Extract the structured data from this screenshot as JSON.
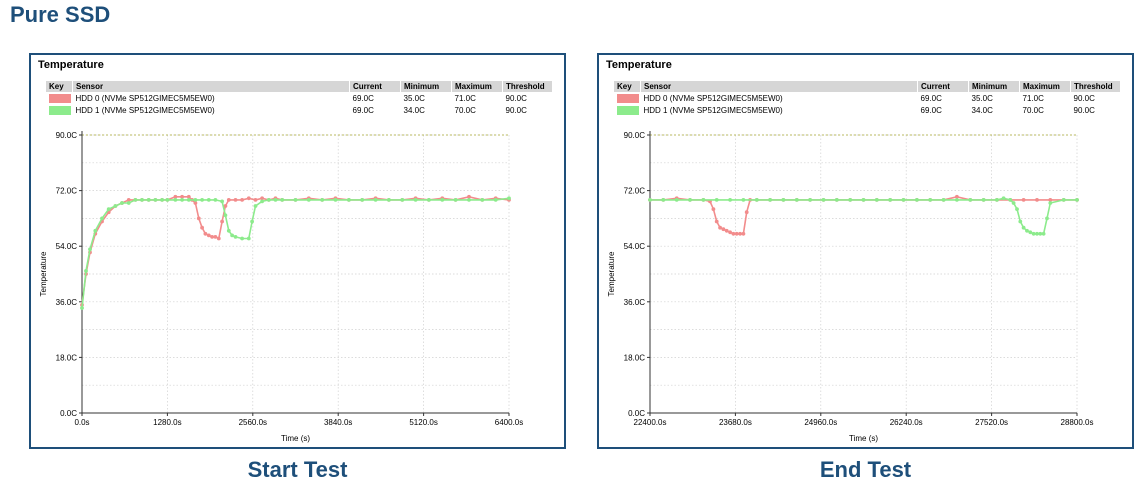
{
  "page_title": "Pure SSD",
  "panels": [
    {
      "title": "Temperature",
      "caption": "Start Test",
      "table": {
        "headers": [
          "Key",
          "Sensor",
          "Current",
          "Minimum",
          "Maximum",
          "Threshold"
        ],
        "rows": [
          {
            "sensor": "HDD 0 (NVMe SP512GIMEC5M5EW0)",
            "current": "69.0C",
            "minimum": "35.0C",
            "maximum": "71.0C",
            "threshold": "90.0C"
          },
          {
            "sensor": "HDD 1 (NVMe SP512GIMEC5M5EW0)",
            "current": "69.0C",
            "minimum": "34.0C",
            "maximum": "70.0C",
            "threshold": "90.0C"
          }
        ]
      }
    },
    {
      "title": "Temperature",
      "caption": "End Test",
      "table": {
        "headers": [
          "Key",
          "Sensor",
          "Current",
          "Minimum",
          "Maximum",
          "Threshold"
        ],
        "rows": [
          {
            "sensor": "HDD 0 (NVMe SP512GIMEC5M5EW0)",
            "current": "69.0C",
            "minimum": "35.0C",
            "maximum": "71.0C",
            "threshold": "90.0C"
          },
          {
            "sensor": "HDD 1 (NVMe SP512GIMEC5M5EW0)",
            "current": "69.0C",
            "minimum": "34.0C",
            "maximum": "70.0C",
            "threshold": "90.0C"
          }
        ]
      }
    }
  ],
  "chart_data": [
    {
      "type": "line",
      "xlabel": "Time (s)",
      "ylabel": "Temperature",
      "xlim": [
        0,
        6400
      ],
      "ylim": [
        0,
        90
      ],
      "x_ticks": [
        0,
        1280,
        2560,
        3840,
        5120,
        6400
      ],
      "x_tick_labels": [
        "0.0s",
        "1280.0s",
        "2560.0s",
        "3840.0s",
        "5120.0s",
        "6400.0s"
      ],
      "y_ticks": [
        0,
        18,
        36,
        54,
        72,
        90
      ],
      "y_tick_labels": [
        "0.0C",
        "18.0C",
        "36.0C",
        "54.0C",
        "72.0C",
        "90.0C"
      ],
      "threshold": 90,
      "threshold_color": "#b8b860",
      "grid": true,
      "series": [
        {
          "name": "HDD 0 (NVMe SP512GIMEC5M5EW0)",
          "color": "#f28c8c",
          "x": [
            0,
            60,
            120,
            200,
            300,
            400,
            500,
            600,
            700,
            800,
            900,
            1000,
            1100,
            1200,
            1280,
            1400,
            1500,
            1600,
            1650,
            1700,
            1750,
            1800,
            1850,
            1900,
            1950,
            2000,
            2050,
            2100,
            2150,
            2200,
            2300,
            2400,
            2500,
            2600,
            2700,
            2800,
            2900,
            3000,
            3200,
            3400,
            3600,
            3800,
            4000,
            4200,
            4400,
            4600,
            4800,
            5000,
            5200,
            5400,
            5600,
            5800,
            6000,
            6200,
            6400
          ],
          "y": [
            35,
            45,
            52,
            58,
            62,
            65,
            67,
            68,
            69,
            69,
            69,
            69,
            69,
            69,
            69,
            70,
            70,
            70,
            69,
            68,
            63,
            60,
            58,
            57.5,
            57,
            57,
            56.5,
            62,
            67,
            69,
            69,
            69,
            69.5,
            69,
            69.5,
            69,
            69.5,
            69,
            69,
            69.5,
            69,
            69.5,
            69,
            69,
            69.5,
            69,
            69,
            69.5,
            69,
            69.5,
            69,
            70,
            69,
            69.5,
            69
          ]
        },
        {
          "name": "HDD 1 (NVMe SP512GIMEC5M5EW0)",
          "color": "#8ceb8c",
          "x": [
            0,
            60,
            120,
            200,
            300,
            400,
            500,
            600,
            700,
            800,
            900,
            1000,
            1100,
            1200,
            1280,
            1400,
            1500,
            1600,
            1700,
            1800,
            1900,
            2000,
            2100,
            2150,
            2200,
            2250,
            2300,
            2400,
            2500,
            2550,
            2600,
            2700,
            2800,
            2900,
            3000,
            3200,
            3400,
            3600,
            3800,
            4000,
            4200,
            4400,
            4600,
            4800,
            5000,
            5200,
            5400,
            5600,
            5800,
            6000,
            6200,
            6400
          ],
          "y": [
            34,
            46,
            53,
            59,
            63,
            66,
            67,
            68,
            68,
            69,
            69,
            69,
            69,
            69,
            69,
            69,
            69,
            69,
            69,
            69,
            69,
            69,
            68.5,
            64,
            59,
            57.5,
            57,
            56.5,
            56.5,
            62,
            67,
            68.5,
            69,
            69,
            69,
            69,
            69,
            69,
            69,
            69,
            69,
            69,
            69,
            69,
            69,
            69,
            69,
            69,
            69,
            69,
            69,
            69.5
          ]
        }
      ]
    },
    {
      "type": "line",
      "xlabel": "Time (s)",
      "ylabel": "Temperature",
      "xlim": [
        22400,
        28800
      ],
      "ylim": [
        0,
        90
      ],
      "x_ticks": [
        22400,
        23680,
        24960,
        26240,
        27520,
        28800
      ],
      "x_tick_labels": [
        "22400.0s",
        "23680.0s",
        "24960.0s",
        "26240.0s",
        "27520.0s",
        "28800.0s"
      ],
      "y_ticks": [
        0,
        18,
        36,
        54,
        72,
        90
      ],
      "y_tick_labels": [
        "0.0C",
        "18.0C",
        "36.0C",
        "54.0C",
        "72.0C",
        "90.0C"
      ],
      "threshold": 90,
      "threshold_color": "#b8b860",
      "grid": true,
      "series": [
        {
          "name": "HDD 0 (NVMe SP512GIMEC5M5EW0)",
          "color": "#f28c8c",
          "x": [
            22400,
            22600,
            22800,
            23000,
            23200,
            23300,
            23350,
            23400,
            23450,
            23500,
            23550,
            23600,
            23650,
            23700,
            23750,
            23800,
            23850,
            23900,
            24000,
            24200,
            24400,
            24600,
            24800,
            25000,
            25200,
            25400,
            25600,
            25800,
            26000,
            26200,
            26400,
            26600,
            26800,
            27000,
            27200,
            27400,
            27600,
            27800,
            28000,
            28200,
            28400,
            28600,
            28800
          ],
          "y": [
            69,
            69,
            69.5,
            69,
            69,
            68.5,
            66,
            62,
            60,
            59.5,
            59,
            58.5,
            58,
            58,
            58,
            58,
            65,
            69,
            69,
            69,
            69,
            69,
            69,
            69,
            69,
            69,
            69,
            69,
            69,
            69,
            69,
            69,
            69,
            70,
            69,
            69,
            69,
            69,
            69,
            69,
            69,
            69,
            69
          ]
        },
        {
          "name": "HDD 1 (NVMe SP512GIMEC5M5EW0)",
          "color": "#8ceb8c",
          "x": [
            22400,
            22600,
            22800,
            23000,
            23200,
            23400,
            23600,
            23800,
            24000,
            24200,
            24400,
            24600,
            24800,
            25000,
            25200,
            25400,
            25600,
            25800,
            26000,
            26200,
            26400,
            26600,
            26800,
            27000,
            27200,
            27400,
            27600,
            27700,
            27800,
            27850,
            27900,
            27950,
            28000,
            28050,
            28100,
            28150,
            28200,
            28250,
            28300,
            28350,
            28400,
            28600,
            28800
          ],
          "y": [
            69,
            69,
            69,
            69,
            69,
            69,
            69,
            69,
            69,
            69,
            69,
            69,
            69,
            69,
            69,
            69,
            69,
            69,
            69,
            69,
            69,
            69,
            69,
            69,
            69,
            69,
            69,
            69.5,
            69,
            68,
            66,
            62,
            60,
            59,
            58.5,
            58,
            58,
            58,
            58,
            63,
            68,
            69,
            69
          ]
        }
      ]
    }
  ]
}
